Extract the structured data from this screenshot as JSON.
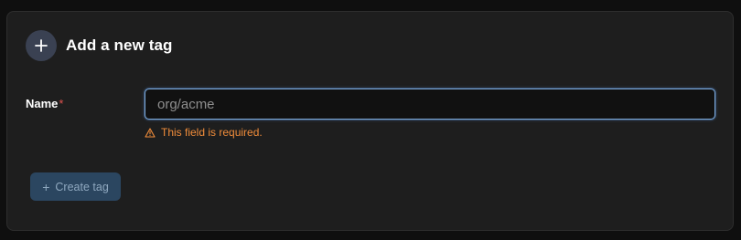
{
  "form": {
    "title": "Add a new tag",
    "plus_icon": "plus-icon",
    "name_label": "Name",
    "required_marker": "*",
    "name_placeholder": "org/acme",
    "name_value": "",
    "error_icon": "warning-triangle-icon",
    "error_message": "This field is required.",
    "create_button": {
      "icon": "+",
      "label": "Create tag",
      "disabled": true
    }
  },
  "colors": {
    "background": "#0f0f0f",
    "card": "#1e1e1e",
    "accent_border": "#7ba7d6",
    "error": "#f08c3a",
    "required": "#e0524f",
    "button_disabled": "#2b4660"
  }
}
